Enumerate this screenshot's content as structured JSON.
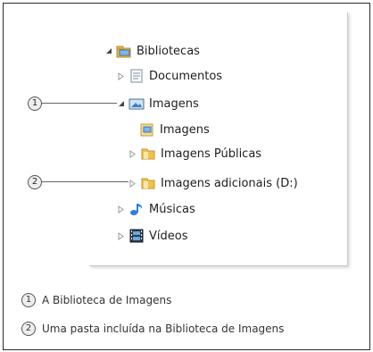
{
  "tree": {
    "items": [
      {
        "label": "Bibliotecas",
        "expander": "expanded",
        "icon": "libraries-icon"
      },
      {
        "label": "Documentos",
        "expander": "collapsed",
        "icon": "documents-library-icon"
      },
      {
        "label": "Imagens",
        "expander": "expanded",
        "icon": "pictures-library-icon"
      },
      {
        "label": "Imagens",
        "expander": "none",
        "icon": "pictures-folder-icon"
      },
      {
        "label": "Imagens Públicas",
        "expander": "collapsed",
        "icon": "folder-icon"
      },
      {
        "label": "Imagens adicionais (D:)",
        "expander": "collapsed",
        "icon": "folder-icon"
      },
      {
        "label": "Músicas",
        "expander": "collapsed",
        "icon": "music-library-icon"
      },
      {
        "label": "Vídeos",
        "expander": "collapsed",
        "icon": "videos-library-icon"
      }
    ]
  },
  "callouts": [
    {
      "number": "1",
      "text": "A Biblioteca de Imagens"
    },
    {
      "number": "2",
      "text": "Uma pasta incluída na Biblioteca de Imagens"
    }
  ]
}
